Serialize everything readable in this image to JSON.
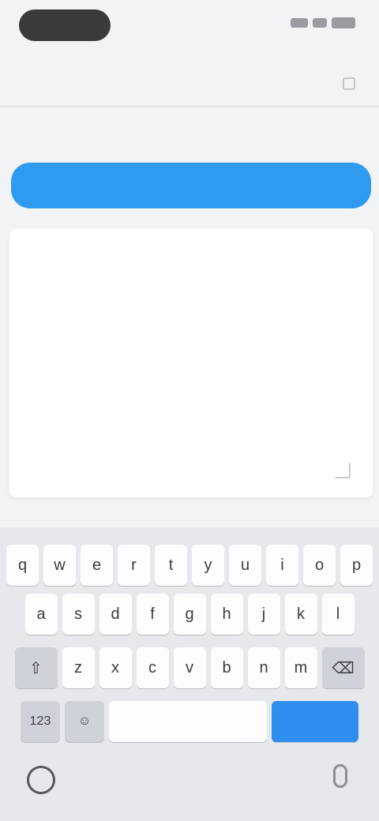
{
  "form": {
    "field_label": "",
    "select_value": "",
    "editor_text": ""
  },
  "keyboard": {
    "row1": [
      "q",
      "w",
      "e",
      "r",
      "t",
      "y",
      "u",
      "i",
      "o",
      "p"
    ],
    "row2": [
      "a",
      "s",
      "d",
      "f",
      "g",
      "h",
      "j",
      "k",
      "l"
    ],
    "row3": [
      "z",
      "x",
      "c",
      "v",
      "b",
      "n",
      "m"
    ],
    "shift_icon": "⇧",
    "backspace_icon": "⌫",
    "numbers_label": "123",
    "emoji_icon": "☺",
    "space_label": "",
    "enter_label": ""
  },
  "icons": {
    "globe": "globe-icon",
    "mic": "microphone-icon"
  },
  "colors": {
    "accent": "#2f9bf0",
    "enter_key": "#2f8ff0",
    "background": "#f2f3f5"
  }
}
